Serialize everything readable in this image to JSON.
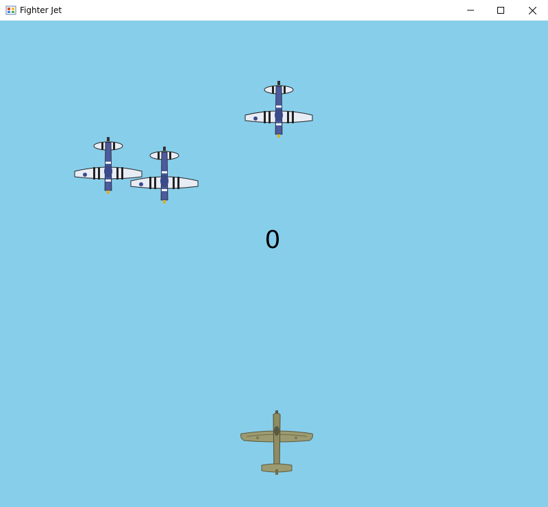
{
  "window": {
    "title": "Fighter Jet",
    "icon": "app-window-icon",
    "controls": [
      "minimize-icon",
      "maximize-icon",
      "close-icon"
    ]
  },
  "game": {
    "background_color": "#87CEEB",
    "score": "0",
    "enemy_count": 3,
    "enemy_sprite": "enemy-plane-icon",
    "player_sprite": "player-plane-icon"
  }
}
